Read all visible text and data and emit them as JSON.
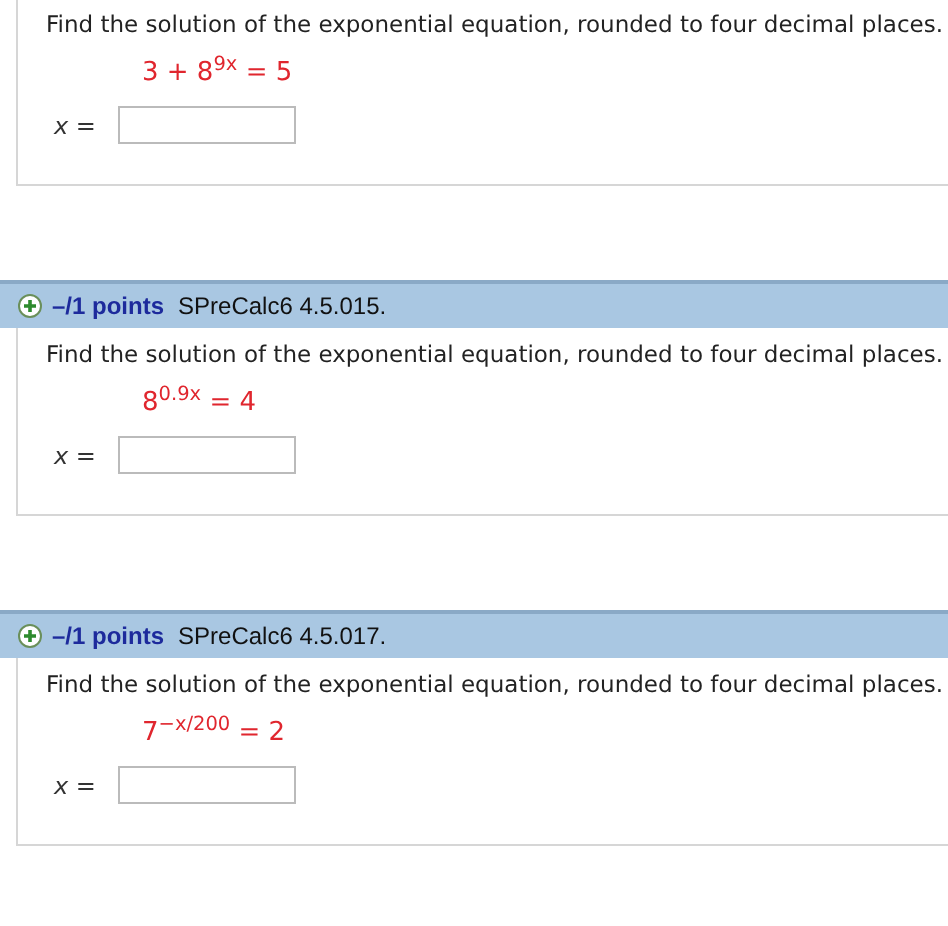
{
  "problems": [
    {
      "prompt": "Find the solution of the exponential equation, rounded to four decimal places.",
      "equation": "3 + 8$^{9x}$ = 5",
      "answer_label": "x ="
    },
    {
      "header": {
        "points": "–/1 points",
        "source": "SPreCalc6 4.5.015."
      },
      "prompt": "Find the solution of the exponential equation, rounded to four decimal places.",
      "equation": "8$^{0.9x}$ = 4",
      "answer_label": "x ="
    },
    {
      "header": {
        "points": "–/1 points",
        "source": "SPreCalc6 4.5.017."
      },
      "prompt": "Find the solution of the exponential equation, rounded to four decimal places.",
      "equation": "7$^{−x/200}$ = 2",
      "answer_label": "x ="
    }
  ]
}
